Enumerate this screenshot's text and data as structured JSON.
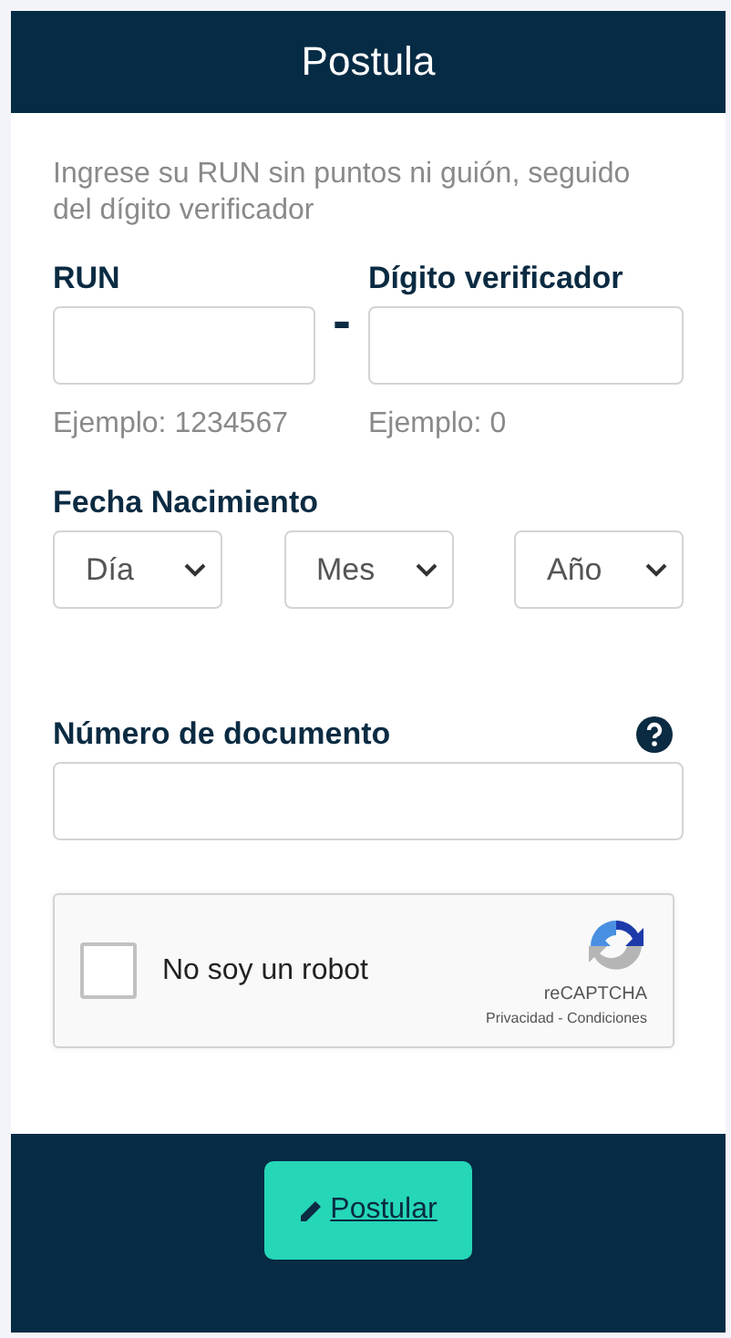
{
  "header": {
    "title": "Postula"
  },
  "instructions": "Ingrese su RUN sin puntos ni guión, seguido del dígito verificador",
  "run": {
    "label": "RUN",
    "example": "Ejemplo: 1234567"
  },
  "separator": "-",
  "dv": {
    "label": "Dígito verificador",
    "example": "Ejemplo: 0"
  },
  "birth_date": {
    "label": "Fecha Nacimiento",
    "selects": [
      "Día",
      "Mes",
      "Año"
    ]
  },
  "document": {
    "label": "Número de documento"
  },
  "captcha": {
    "label": "No soy un robot",
    "checked": false,
    "brand": "reCAPTCHA",
    "links": "Privacidad - Condiciones"
  },
  "submit": {
    "label": "Postular"
  }
}
